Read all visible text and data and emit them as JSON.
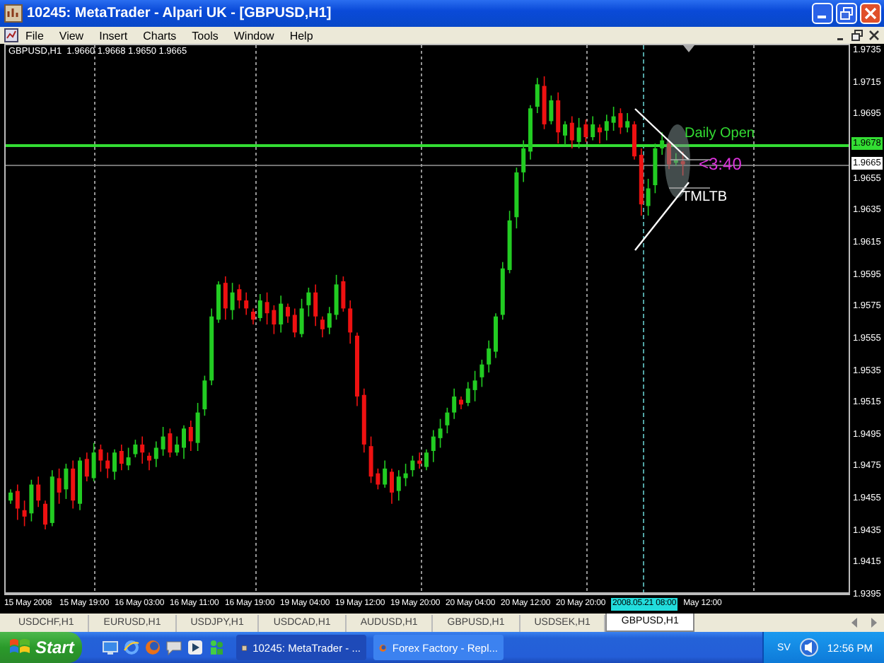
{
  "window": {
    "title": "10245: MetaTrader - Alpari UK - [GBPUSD,H1]"
  },
  "menu": [
    "File",
    "View",
    "Insert",
    "Charts",
    "Tools",
    "Window",
    "Help"
  ],
  "chart": {
    "header": "GBPUSD,H1  1.9660 1.9668 1.9650 1.9665",
    "annotations": [
      {
        "kind": "daily_open",
        "text": "Daily Open"
      },
      {
        "kind": "countdown",
        "text": "<3:40"
      },
      {
        "kind": "pattern",
        "text": "TMLTB"
      }
    ],
    "price_axis": [
      {
        "kind": "tick",
        "text": "1.9735"
      },
      {
        "kind": "tick",
        "text": "1.9715"
      },
      {
        "kind": "tick",
        "text": "1.9695"
      },
      {
        "kind": "daily_open",
        "text": "1.9678"
      },
      {
        "kind": "bid",
        "text": "1.9665"
      },
      {
        "kind": "tick",
        "text": "1.9655"
      },
      {
        "kind": "tick",
        "text": "1.9635"
      },
      {
        "kind": "tick",
        "text": "1.9615"
      },
      {
        "kind": "tick",
        "text": "1.9595"
      },
      {
        "kind": "tick",
        "text": "1.9575"
      },
      {
        "kind": "tick",
        "text": "1.9555"
      },
      {
        "kind": "tick",
        "text": "1.9535"
      },
      {
        "kind": "tick",
        "text": "1.9515"
      },
      {
        "kind": "tick",
        "text": "1.9495"
      },
      {
        "kind": "tick",
        "text": "1.9475"
      },
      {
        "kind": "tick",
        "text": "1.9455"
      },
      {
        "kind": "tick",
        "text": "1.9435"
      },
      {
        "kind": "tick",
        "text": "1.9415"
      },
      {
        "kind": "tick",
        "text": "1.9395"
      }
    ],
    "time_axis": [
      {
        "text": "15 May 2008",
        "selected": false
      },
      {
        "text": "15 May 19:00",
        "selected": false
      },
      {
        "text": "16 May 03:00",
        "selected": false
      },
      {
        "text": "16 May 11:00",
        "selected": false
      },
      {
        "text": "16 May 19:00",
        "selected": false
      },
      {
        "text": "19 May 04:00",
        "selected": false
      },
      {
        "text": "19 May 12:00",
        "selected": false
      },
      {
        "text": "19 May 20:00",
        "selected": false
      },
      {
        "text": "20 May 04:00",
        "selected": false
      },
      {
        "text": "20 May 12:00",
        "selected": false
      },
      {
        "text": "20 May 20:00",
        "selected": false
      },
      {
        "text": "2008.05.21 08:00",
        "selected": true
      },
      {
        "text": "May 12:00",
        "selected": false
      }
    ]
  },
  "symbol_tabs": [
    {
      "label": "USDCHF,H1",
      "selected": false
    },
    {
      "label": "EURUSD,H1",
      "selected": false
    },
    {
      "label": "USDJPY,H1",
      "selected": false
    },
    {
      "label": "USDCAD,H1",
      "selected": false
    },
    {
      "label": "AUDUSD,H1",
      "selected": false
    },
    {
      "label": "GBPUSD,H1",
      "selected": false
    },
    {
      "label": "USDSEK,H1",
      "selected": false
    },
    {
      "label": "GBPUSD,H1",
      "selected": true
    }
  ],
  "taskbar": {
    "start": "Start",
    "tasks": [
      {
        "label": "10245: MetaTrader - ...",
        "selected": true
      },
      {
        "label": "Forex Factory - Repl...",
        "selected": false
      }
    ],
    "language": "SV",
    "clock": "12:56 PM"
  }
}
